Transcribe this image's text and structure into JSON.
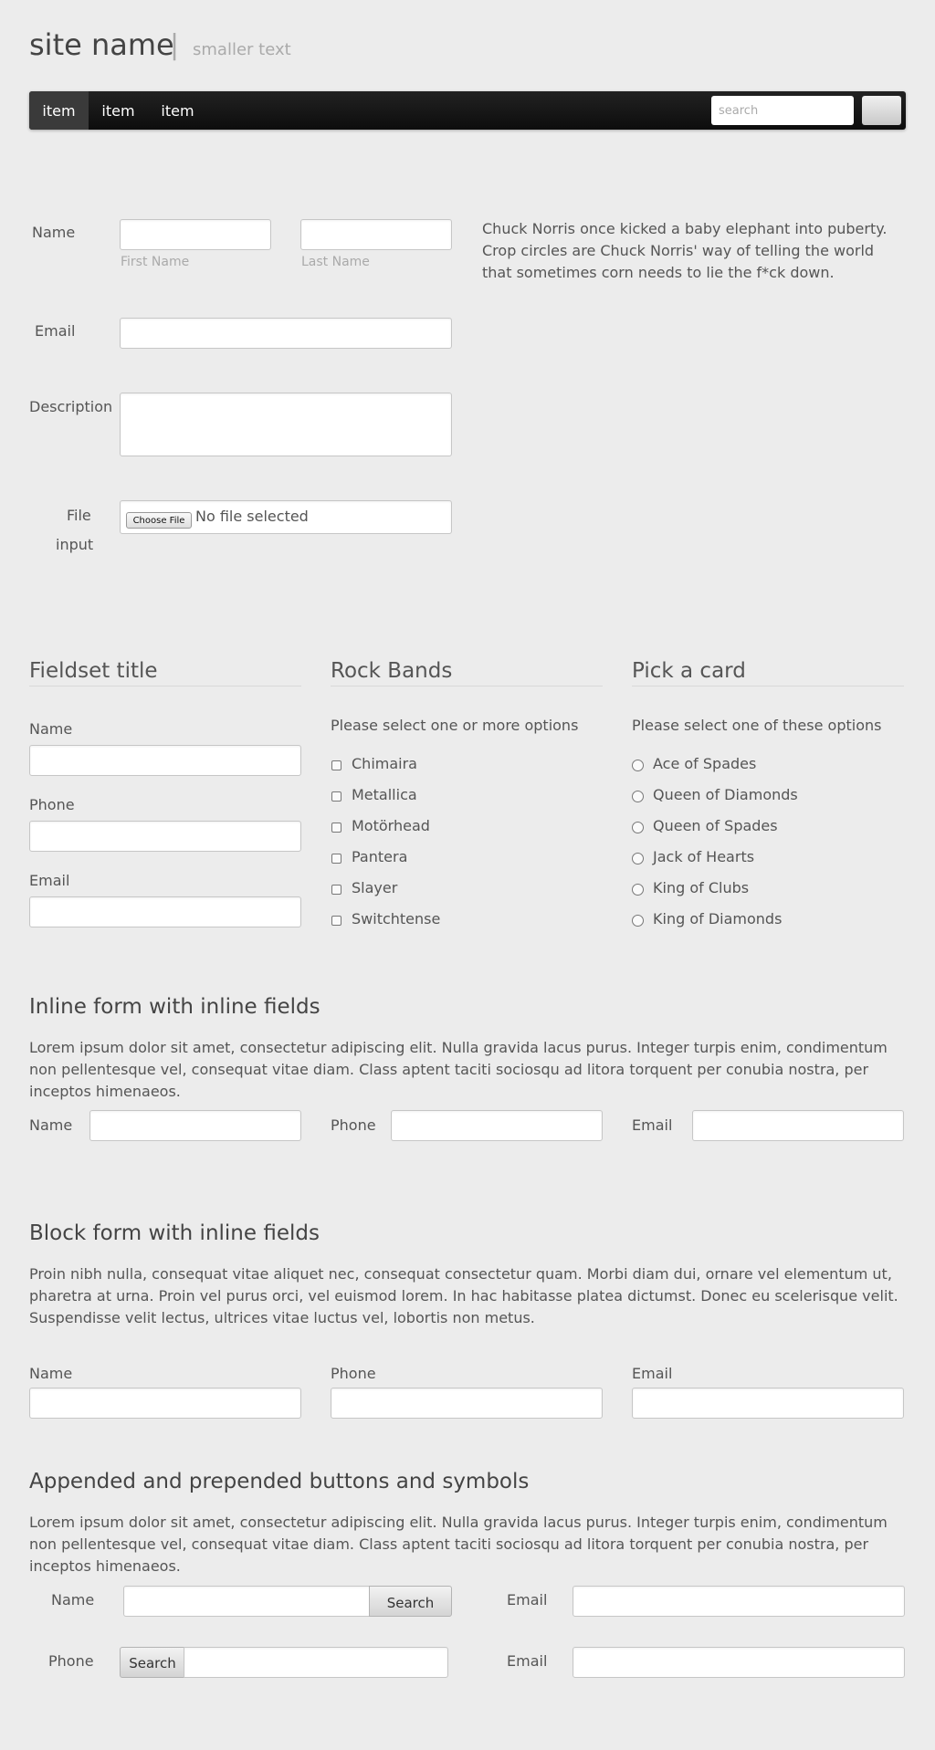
{
  "header": {
    "site_name": "site name",
    "divider": "|",
    "tagline": "smaller text"
  },
  "navbar": {
    "items": [
      {
        "label": "item",
        "active": true
      },
      {
        "label": "item",
        "active": false
      },
      {
        "label": "item",
        "active": false
      }
    ],
    "search_placeholder": "search",
    "button_label": ""
  },
  "form1": {
    "name_label": "Name",
    "first_name_hint": "First Name",
    "last_name_hint": "Last Name",
    "email_label": "Email",
    "description_label": "Description",
    "file_label_line1": "File",
    "file_label_line2": "input",
    "choose_file_label": "Choose File",
    "no_file_text": "No file selected",
    "aside_text": "Chuck Norris once kicked a baby elephant into puberty. Crop circles are Chuck Norris' way of telling the world that sometimes corn needs to lie the f*ck down."
  },
  "fieldsets": {
    "fieldset1": {
      "title": "Fieldset title",
      "name_label": "Name",
      "phone_label": "Phone",
      "email_label": "Email"
    },
    "rock_bands": {
      "title": "Rock Bands",
      "prompt": "Please select one or more options",
      "options": [
        "Chimaira",
        "Metallica",
        "Motörhead",
        "Pantera",
        "Slayer",
        "Switchtense"
      ]
    },
    "pick_card": {
      "title": "Pick a card",
      "prompt": "Please select one of these options",
      "options": [
        "Ace of Spades",
        "Queen of Diamonds",
        "Queen of Spades",
        "Jack of Hearts",
        "King of Clubs",
        "King of Diamonds"
      ]
    }
  },
  "inline_form": {
    "title": "Inline form with inline fields",
    "text": "Lorem ipsum dolor sit amet, consectetur adipiscing elit. Nulla gravida lacus purus. Integer turpis enim, condimentum non pellentesque vel, consequat vitae diam. Class aptent taciti sociosqu ad litora torquent per conubia nostra, per inceptos himenaeos.",
    "name_label": "Name",
    "phone_label": "Phone",
    "email_label": "Email"
  },
  "block_form": {
    "title": "Block form with inline fields",
    "text": "Proin nibh nulla, consequat vitae aliquet nec, consequat consectetur quam. Morbi diam dui, ornare vel elementum ut, pharetra at urna. Proin vel purus orci, vel euismod lorem. In hac habitasse platea dictumst. Donec eu scelerisque velit. Suspendisse velit lectus, ultrices vitae luctus vel, lobortis non metus.",
    "name_label": "Name",
    "phone_label": "Phone",
    "email_label": "Email"
  },
  "append_form": {
    "title": "Appended and prepended buttons and symbols",
    "text": "Lorem ipsum dolor sit amet, consectetur adipiscing elit. Nulla gravida lacus purus. Integer turpis enim, condimentum non pellentesque vel, consequat vitae diam. Class aptent taciti sociosqu ad litora torquent per conubia nostra, per inceptos himenaeos.",
    "name_label": "Name",
    "phone_label": "Phone",
    "email_label_1": "Email",
    "email_label_2": "Email",
    "append_button": "Search",
    "prepend_button": "Search"
  }
}
